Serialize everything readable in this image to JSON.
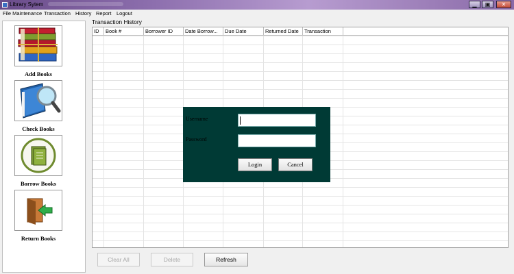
{
  "window": {
    "title": "Library Sytem"
  },
  "menu": [
    "File Maintenance",
    "Transaction",
    "History",
    "Report",
    "Logout"
  ],
  "sidebar": {
    "items": [
      {
        "label": "Add Books",
        "icon": "books-stack-icon"
      },
      {
        "label": "Check Books",
        "icon": "book-magnifier-icon"
      },
      {
        "label": "Borrow Books",
        "icon": "book-circle-icon"
      },
      {
        "label": "Return Books",
        "icon": "door-arrow-icon"
      }
    ]
  },
  "main": {
    "title": "Transaction History",
    "columns": [
      "ID",
      "Book #",
      "Borrower ID",
      "Date Borrow...",
      "Due Date",
      "Returned Date",
      "Transaction"
    ],
    "buttons": {
      "clear_all": "Clear All",
      "delete": "Delete",
      "refresh": "Refresh"
    }
  },
  "login": {
    "username_label": "Username",
    "password_label": "Password",
    "username_value": "",
    "password_value": "",
    "login_label": "Login",
    "cancel_label": "Cancel",
    "bg_color": "#003a35"
  }
}
